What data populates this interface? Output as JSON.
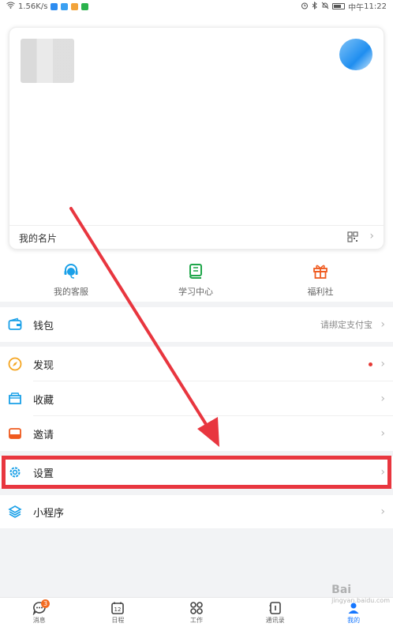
{
  "status_bar": {
    "network_speed": "1.56K/s",
    "period": "中午",
    "time": "11:22"
  },
  "card": {
    "title": "我的名片"
  },
  "quick_actions": [
    {
      "label": "我的客服",
      "icon": "headset-icon",
      "color": "#1aa0e8"
    },
    {
      "label": "学习中心",
      "icon": "book-icon",
      "color": "#1fa64a"
    },
    {
      "label": "福利社",
      "icon": "gift-icon",
      "color": "#ef5a1f"
    }
  ],
  "list": {
    "wallet": {
      "label": "钱包",
      "hint": "请绑定支付宝"
    },
    "discover": {
      "label": "发现"
    },
    "favorites": {
      "label": "收藏"
    },
    "invite": {
      "label": "邀请"
    },
    "settings": {
      "label": "设置"
    },
    "mini_programs": {
      "label": "小程序"
    }
  },
  "bottom_nav": [
    {
      "label": "消息",
      "badge": "3"
    },
    {
      "label": "日程",
      "icon_text": "12"
    },
    {
      "label": "工作"
    },
    {
      "label": "通讯录"
    },
    {
      "label": "我的",
      "active": true
    }
  ],
  "watermark": {
    "brand": "Bai",
    "sub": "jingyan.baidu.com"
  },
  "colors": {
    "accent": "#1677ff",
    "highlight": "#e8363f",
    "badge": "#f36b21"
  }
}
